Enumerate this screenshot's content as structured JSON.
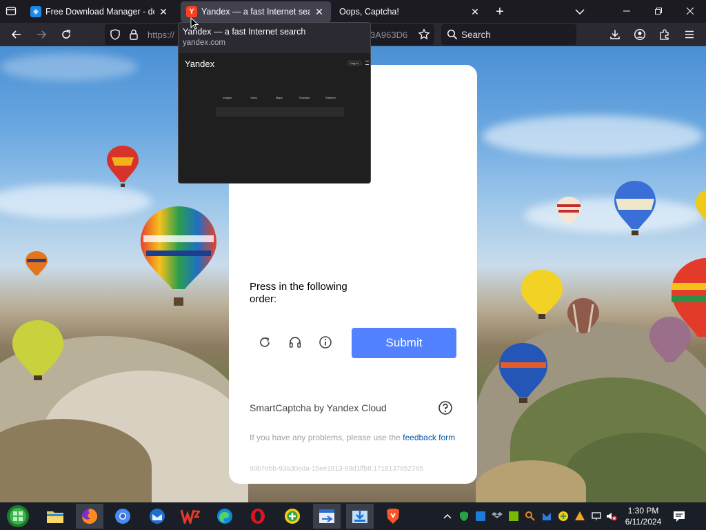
{
  "browser": {
    "tabs": [
      {
        "title": "Free Download Manager - down",
        "favicon_color": "#1e88e5",
        "active": false
      },
      {
        "title": "Yandex — a fast Internet search",
        "favicon_letter": "Y",
        "favicon_color": "#fc3f1d",
        "active": true
      },
      {
        "title": "Oops, Captcha!",
        "active": false
      }
    ],
    "url_prefix": "https://",
    "url_tail": "3A963D6",
    "search_placeholder": "Search"
  },
  "tab_preview": {
    "title": "Yandex — a fast Internet search",
    "url": "yandex.com",
    "thumb_logo": "Yandex",
    "thumb_login": "Log in",
    "thumb_nav": [
      "Images",
      "Video",
      "Maps",
      "Translate",
      "Weather"
    ]
  },
  "captcha": {
    "instruction": "Press in the following order:",
    "submit_label": "Submit",
    "brand": "SmartCaptcha by Yandex Cloud",
    "problems_text": "If you have any problems, please use the ",
    "feedback_link": "feedback form",
    "token": "90b7ebb-93a30eda-15ee1813-69d1ffb8:1718137852765",
    "accent_color": "#5282ff"
  },
  "taskbar": {
    "apps": [
      "start",
      "file-explorer",
      "firefox",
      "chromium",
      "thunderbird",
      "wps-office",
      "edge",
      "opera",
      "app-green",
      "app-blue-a",
      "app-blue-b",
      "brave"
    ],
    "time": "1:30 PM",
    "date": "6/11/2024"
  }
}
